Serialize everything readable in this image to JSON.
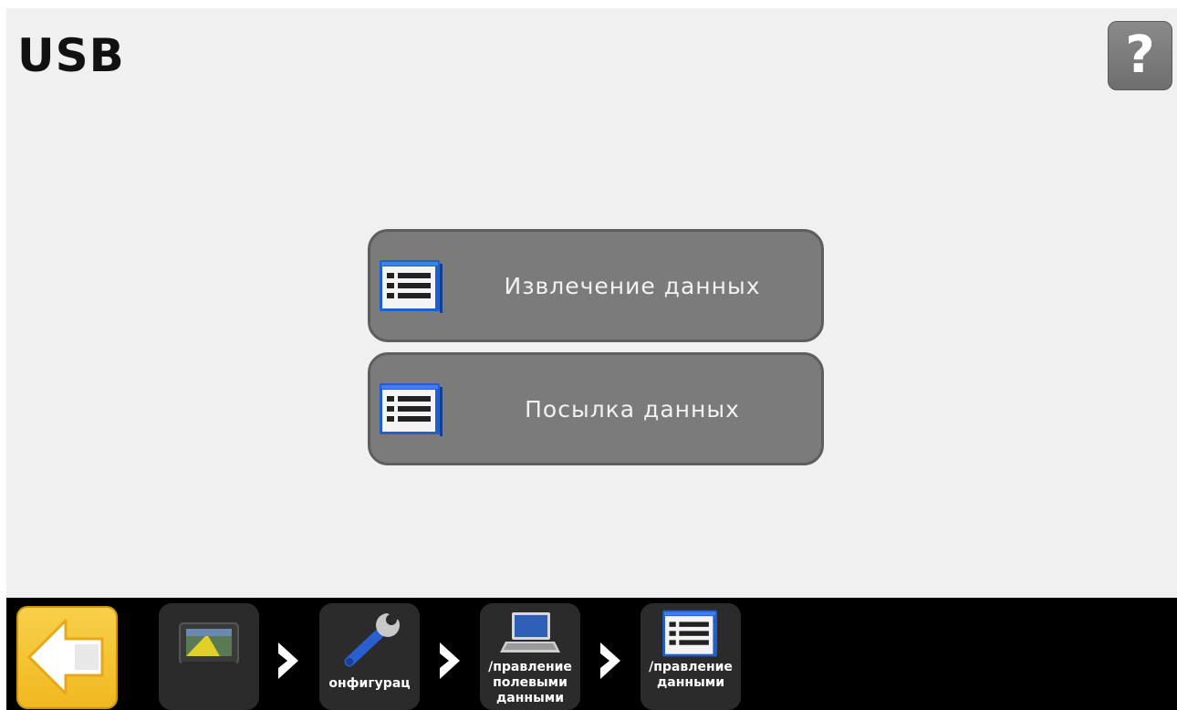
{
  "header": {
    "title": "USB"
  },
  "help": {
    "icon": "help-icon",
    "glyph": "?"
  },
  "menu": {
    "items": [
      {
        "label": "Извлечение данных",
        "icon": "list-icon"
      },
      {
        "label": "Посылка данных",
        "icon": "list-icon"
      }
    ]
  },
  "breadcrumb": {
    "back_icon": "back-arrow-icon",
    "items": [
      {
        "label": "",
        "icon": "display-terminal-icon"
      },
      {
        "label": "онфигурац",
        "icon": "wrench-icon"
      },
      {
        "label": "/правление\nполевыми\nданными",
        "icon": "laptop-icon"
      },
      {
        "label": "/правление\nданными",
        "icon": "list-icon"
      }
    ]
  },
  "colors": {
    "background": "#f0f0f0",
    "button": "#7b7b7b",
    "bottom_bar": "#000000",
    "back_button": "#f2bf2a",
    "list_icon_accent": "#1f5fd0"
  }
}
